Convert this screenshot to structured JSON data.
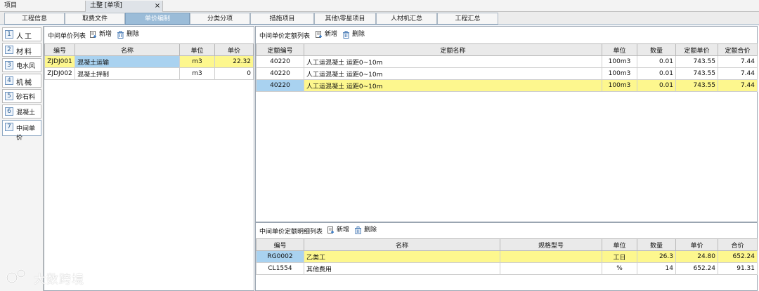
{
  "window": {
    "tabs": [
      {
        "label": "项目"
      },
      {
        "label": "土整 [单项]"
      }
    ],
    "close_glyph": "×"
  },
  "tabs": [
    "工程信息",
    "取费文件",
    "单价编制",
    "分类分项",
    "措施项目",
    "其他\\零星项目",
    "人材机汇总",
    "工程汇总"
  ],
  "active_tab": "单价编制",
  "sidebar": {
    "items": [
      {
        "num": "1",
        "label": "人工"
      },
      {
        "num": "2",
        "label": "材料"
      },
      {
        "num": "3",
        "label": "电水风"
      },
      {
        "num": "4",
        "label": "机械"
      },
      {
        "num": "5",
        "label": "砂石料"
      },
      {
        "num": "6",
        "label": "混凝土"
      },
      {
        "num": "7",
        "label": "中间单价"
      }
    ]
  },
  "list_panel": {
    "title": "中间单价列表",
    "add_label": "新增",
    "delete_label": "删除",
    "columns": [
      "编号",
      "名称",
      "单位",
      "单价"
    ],
    "rows": [
      {
        "code": "ZJDJ001",
        "name": "混凝土运输",
        "unit": "m3",
        "price": "22.32"
      },
      {
        "code": "ZJDJ002",
        "name": "混凝土拌制",
        "unit": "m3",
        "price": "0"
      }
    ]
  },
  "quota_panel": {
    "title": "中间单价定额列表",
    "add_label": "新增",
    "delete_label": "删除",
    "columns": [
      "定额编号",
      "定额名称",
      "单位",
      "数量",
      "定额单价",
      "定额合价"
    ],
    "rows": [
      {
        "code": "40220",
        "name": "人工运混凝土 运距0~10m",
        "unit": "100m3",
        "qty": "0.01",
        "price": "743.55",
        "total": "7.44"
      },
      {
        "code": "40220",
        "name": "人工运混凝土 运距0~10m",
        "unit": "100m3",
        "qty": "0.01",
        "price": "743.55",
        "total": "7.44"
      },
      {
        "code": "40220",
        "name": "人工运混凝土 运距0~10m",
        "unit": "100m3",
        "qty": "0.01",
        "price": "743.55",
        "total": "7.44"
      }
    ]
  },
  "detail_panel": {
    "title": "中间单价定额明细列表",
    "add_label": "新增",
    "delete_label": "删除",
    "columns": [
      "编号",
      "名称",
      "规格型号",
      "单位",
      "数量",
      "单价",
      "合价"
    ],
    "rows": [
      {
        "code": "RG0002",
        "name": "乙类工",
        "spec": "",
        "unit": "工日",
        "qty": "26.3",
        "price": "24.80",
        "total": "652.24"
      },
      {
        "code": "CL1554",
        "name": "其他费用",
        "spec": "",
        "unit": "%",
        "qty": "14",
        "price": "652.24",
        "total": "91.31"
      }
    ]
  },
  "watermark": {
    "text": "大数跨境"
  },
  "icons": {
    "add": "add-doc-icon",
    "delete": "trash-icon"
  },
  "colors": {
    "selected_blue": "#a9d2f0",
    "selected_yellow": "#fdf78e",
    "active_tab": "#9bbcd8"
  }
}
